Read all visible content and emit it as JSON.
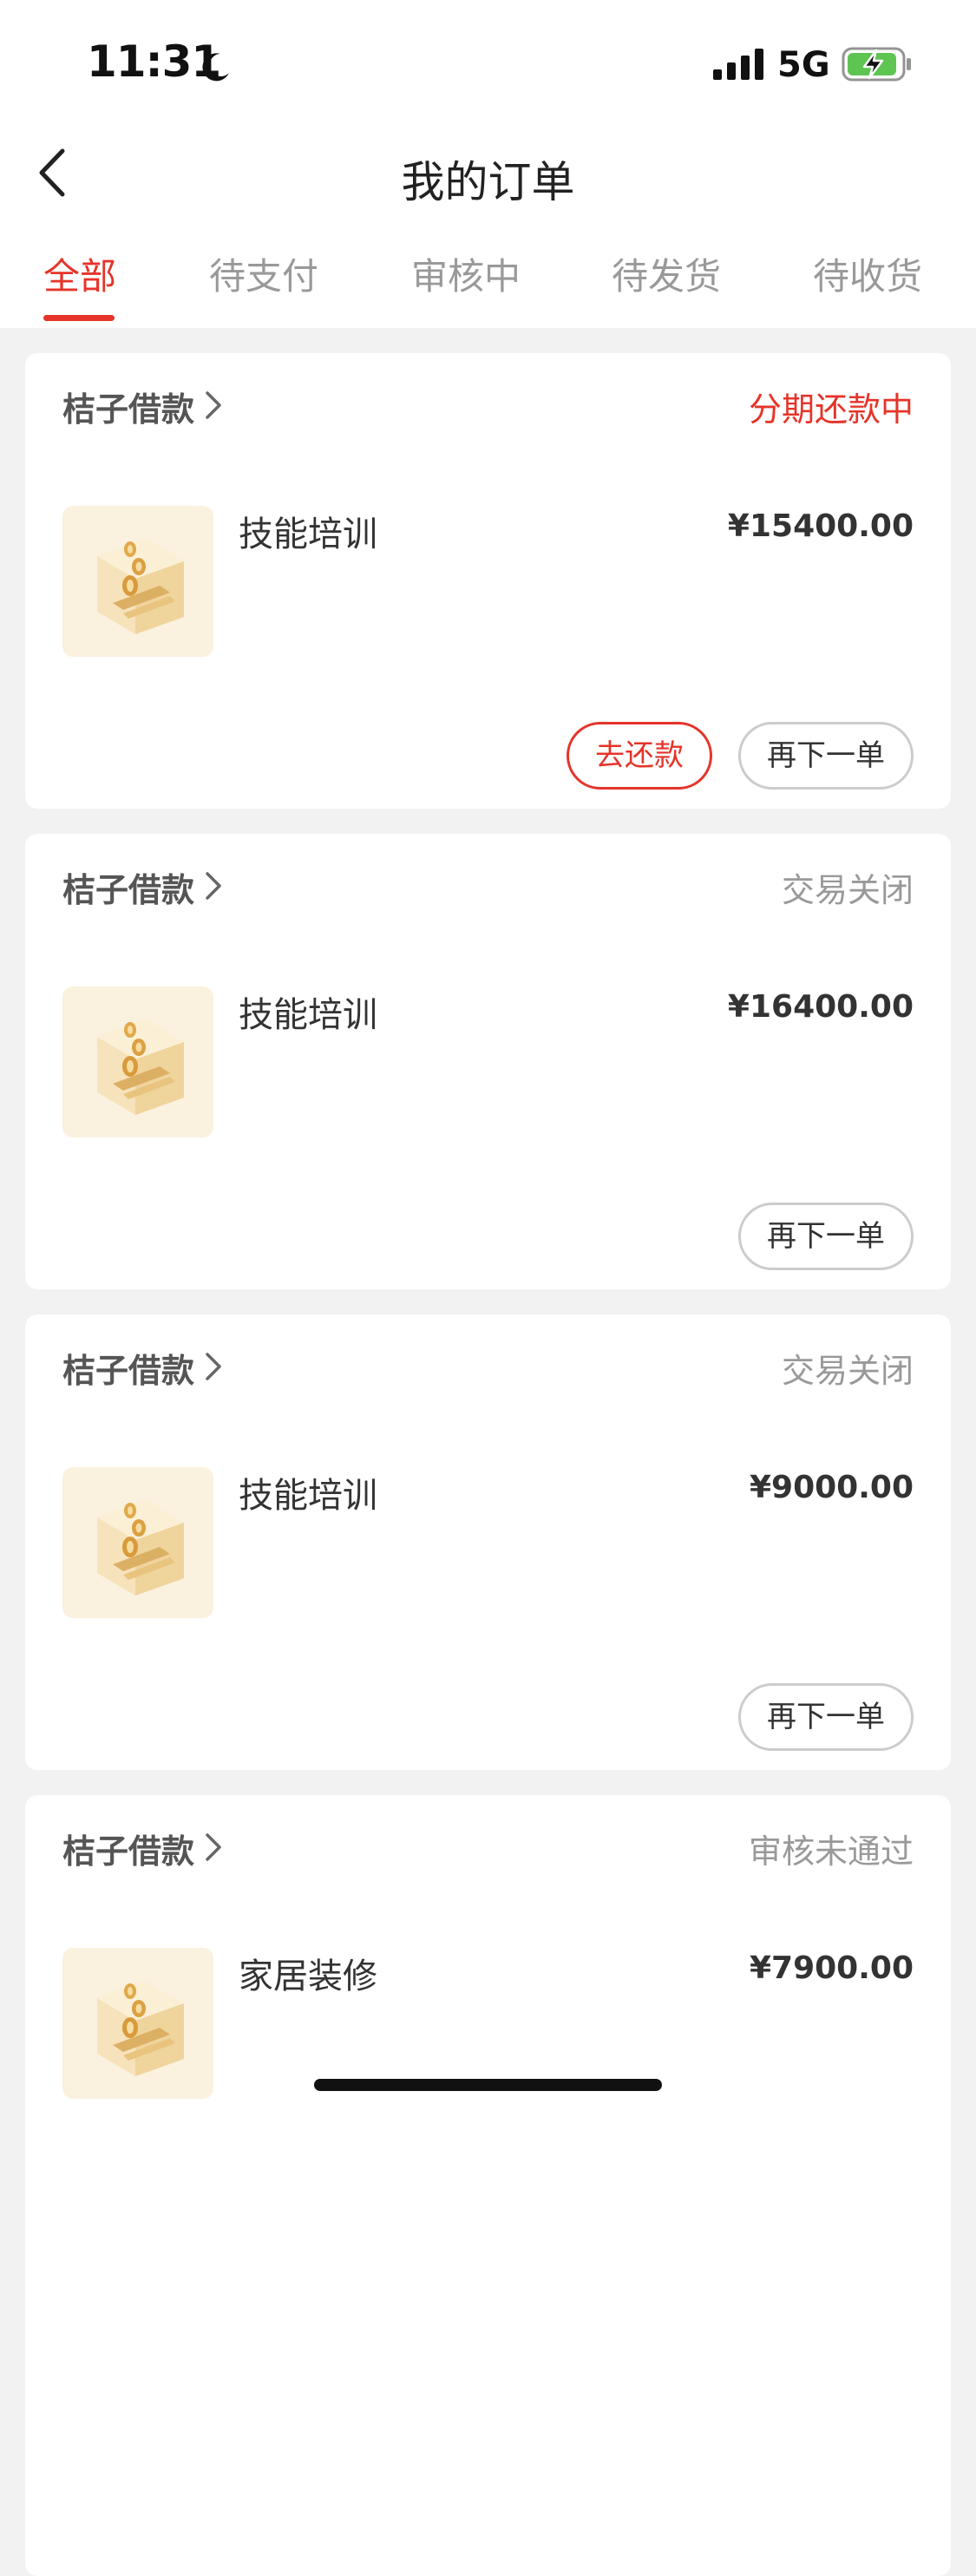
{
  "status_bar": {
    "time": "11:31",
    "network": "5G",
    "moon_icon": "moon-icon",
    "signal_icon": "signal-icon",
    "battery_icon": "battery-charging-icon"
  },
  "header": {
    "title": "我的订单",
    "back_icon": "chevron-left-icon"
  },
  "tabs": [
    {
      "label": "全部",
      "active": true
    },
    {
      "label": "待支付",
      "active": false
    },
    {
      "label": "审核中",
      "active": false
    },
    {
      "label": "待发货",
      "active": false
    },
    {
      "label": "待收货",
      "active": false
    }
  ],
  "orders": [
    {
      "merchant": "桔子借款",
      "status": "分期还款中",
      "product": "技能培训",
      "price": "¥15400.00",
      "repay_label": "去还款",
      "reorder_label": "再下一单"
    },
    {
      "merchant": "桔子借款",
      "status": "交易关闭",
      "product": "技能培训",
      "price": "¥16400.00",
      "reorder_label": "再下一单"
    },
    {
      "merchant": "桔子借款",
      "status": "交易关闭",
      "product": "技能培训",
      "price": "¥9000.00",
      "reorder_label": "再下一单"
    },
    {
      "merchant": "桔子借款",
      "status": "审核未通过",
      "product": "家居装修",
      "price": "¥7900.00"
    }
  ],
  "colors": {
    "accent": "#e5342a",
    "background": "#f2f2f2",
    "card": "#ffffff",
    "muted_text": "#999999",
    "thumbnail_bg": "#fbf1df"
  }
}
